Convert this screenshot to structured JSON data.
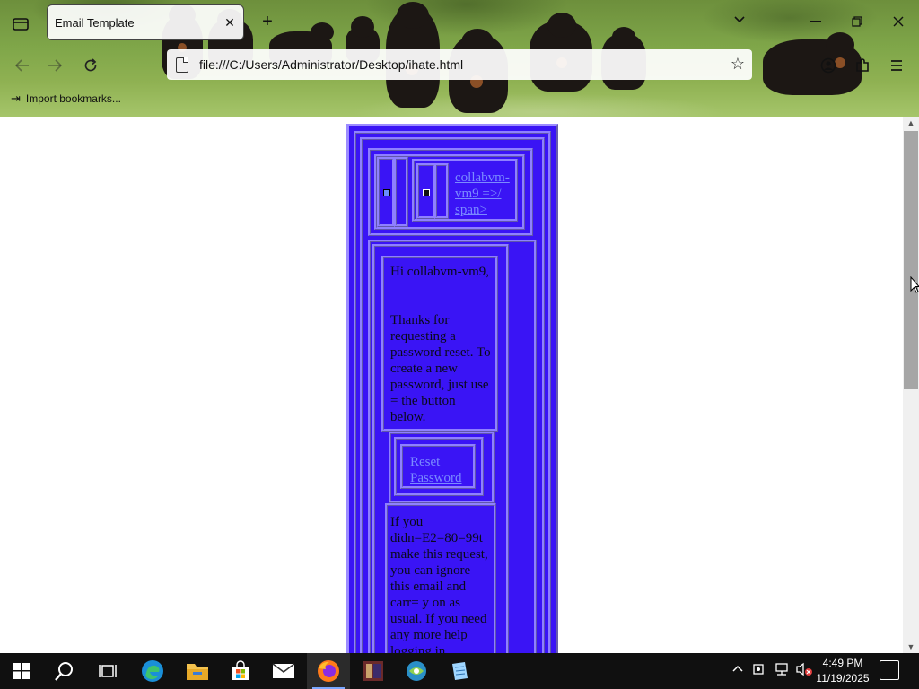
{
  "browser": {
    "tab_title": "Email Template",
    "url": "file:///C:/Users/Administrator/Desktop/ihate.html",
    "bookmark_import_label": "Import bookmarks..."
  },
  "email": {
    "header_link": "collabvm-vm9 =>/ span>",
    "greeting": "Hi collabvm-vm9,",
    "message": "Thanks for requesting a password reset. To create a new password, just use = the button below.",
    "button_label": "Reset Password",
    "footer": "If you didn=E2=80=99t make this request, you can ignore this email and carr= y on as usual. If you need any more help logging in"
  },
  "colors": {
    "email_bg": "#3a14f5",
    "email_border": "#8f80ff",
    "link": "#7b8bff"
  },
  "taskbar": {
    "time": "4:49 PM",
    "date": "11/19/2025",
    "apps": [
      "start-icon",
      "search-icon",
      "task-view-icon",
      "edge-icon",
      "file-explorer-icon",
      "store-icon",
      "mail-icon",
      "firefox-icon",
      "winrar-icon",
      "network-app-icon",
      "notepad-icon"
    ]
  }
}
